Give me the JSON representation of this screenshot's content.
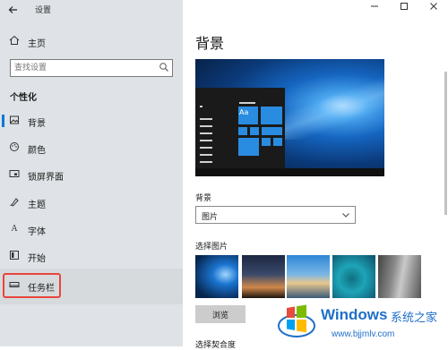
{
  "window": {
    "title": "设置"
  },
  "sidebar": {
    "home_label": "主页",
    "search_placeholder": "查找设置",
    "section_title": "个性化",
    "items": [
      {
        "label": "背景",
        "icon": "background-icon"
      },
      {
        "label": "颜色",
        "icon": "palette-icon"
      },
      {
        "label": "锁屏界面",
        "icon": "lockscreen-icon"
      },
      {
        "label": "主题",
        "icon": "theme-icon"
      },
      {
        "label": "字体",
        "icon": "font-icon"
      },
      {
        "label": "开始",
        "icon": "start-icon"
      },
      {
        "label": "任务栏",
        "icon": "taskbar-icon"
      }
    ],
    "active_index": 0,
    "highlighted_item": "任务栏"
  },
  "main": {
    "title": "背景",
    "preview_tile_text": "Aa",
    "background_label": "背景",
    "background_value": "图片",
    "choose_picture_label": "选择图片",
    "browse_label": "浏览",
    "fit_label": "选择契合度"
  },
  "watermark": {
    "brand": "Windows",
    "chinese": "系统之家",
    "url": "www.bjjmlv.com"
  },
  "colors": {
    "accent": "#0078d7",
    "sidebar_bg": "#dfe3e7",
    "highlight_border": "#e8453c",
    "watermark": "#1f6fc9"
  }
}
